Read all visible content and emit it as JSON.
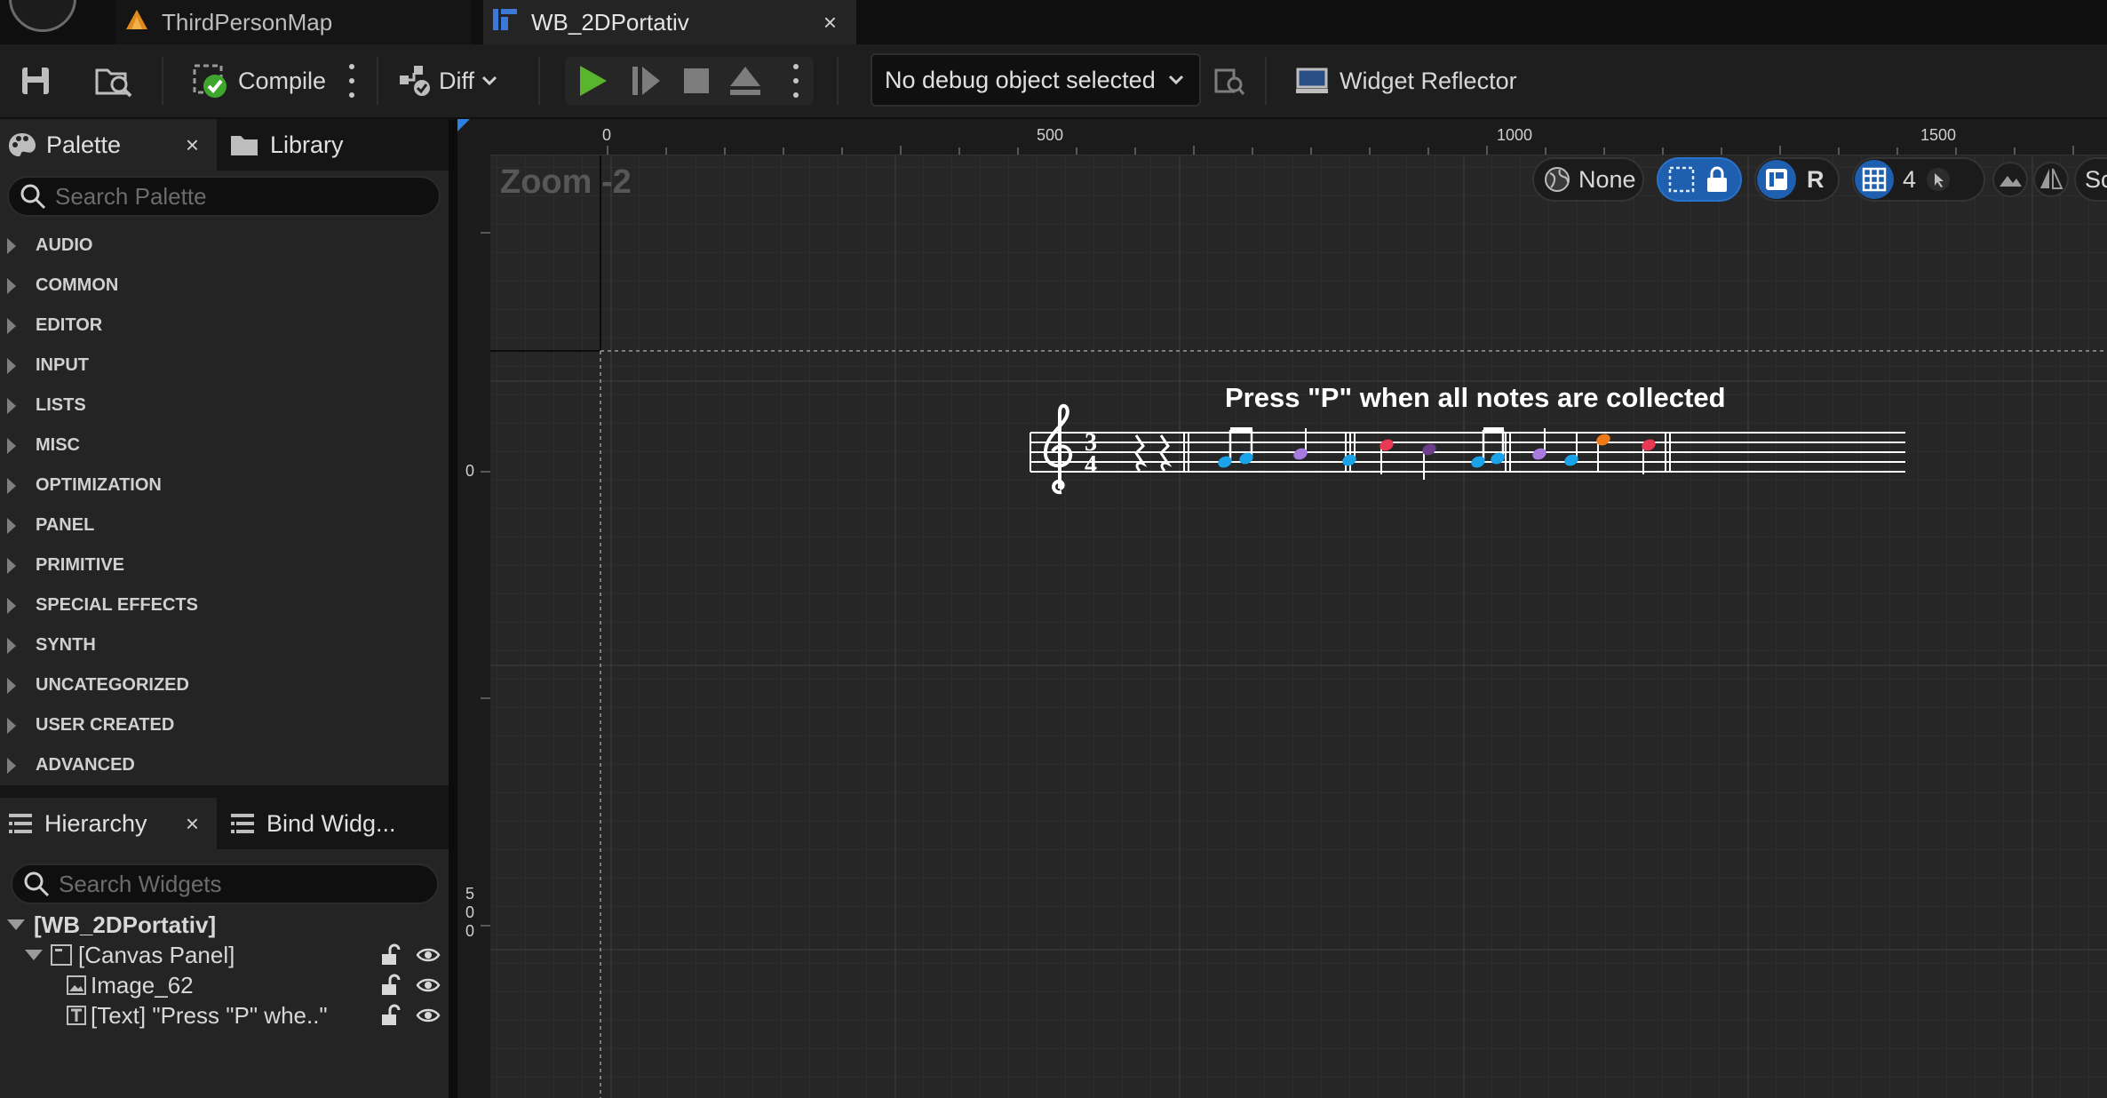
{
  "tabs": [
    {
      "label": "ThirdPersonMap"
    },
    {
      "label": "WB_2DPortativ",
      "close": "×"
    }
  ],
  "toolbar": {
    "compile_label": "Compile",
    "diff_label": "Diff",
    "debug_select_value": "No debug object selected",
    "widget_reflector_label": "Widget Reflector"
  },
  "palette": {
    "tab_label": "Palette",
    "close": "×",
    "library_tab_label": "Library",
    "search_placeholder": "Search Palette",
    "categories": [
      "AUDIO",
      "COMMON",
      "EDITOR",
      "INPUT",
      "LISTS",
      "MISC",
      "OPTIMIZATION",
      "PANEL",
      "PRIMITIVE",
      "SPECIAL EFFECTS",
      "SYNTH",
      "UNCATEGORIZED",
      "USER CREATED",
      "ADVANCED"
    ]
  },
  "hierarchy": {
    "tab_label": "Hierarchy",
    "close": "×",
    "bind_tab_label": "Bind Widg...",
    "search_placeholder": "Search Widgets",
    "root": "[WB_2DPortativ]",
    "items": [
      {
        "label": "[Canvas Panel]"
      },
      {
        "label": "Image_62"
      },
      {
        "label": "[Text] \"Press \"P\" whe..\""
      }
    ]
  },
  "designer": {
    "zoom_label": "Zoom -2",
    "ruler_top": [
      "0",
      "500",
      "1000",
      "1500"
    ],
    "ruler_left": [
      "0",
      "5",
      "0",
      "0"
    ],
    "toolbar": {
      "localization": "None",
      "respect_locks": "R",
      "grid_snap": "4",
      "screen_size": "Scre"
    },
    "widget_text": "Press \"P\" when all notes are collected",
    "time_signature_top": "3",
    "time_signature_bottom": "4",
    "note_colors": {
      "blue": "#1aa3e8",
      "lavender": "#a77ae0",
      "red": "#e83a55",
      "dark_purple": "#6b3d8a",
      "orange": "#ef7a1a"
    }
  },
  "colors": {
    "accent_blue": "#1e5fb0",
    "play_green": "#5ab52e",
    "background": "#151515",
    "panel": "#242424"
  }
}
